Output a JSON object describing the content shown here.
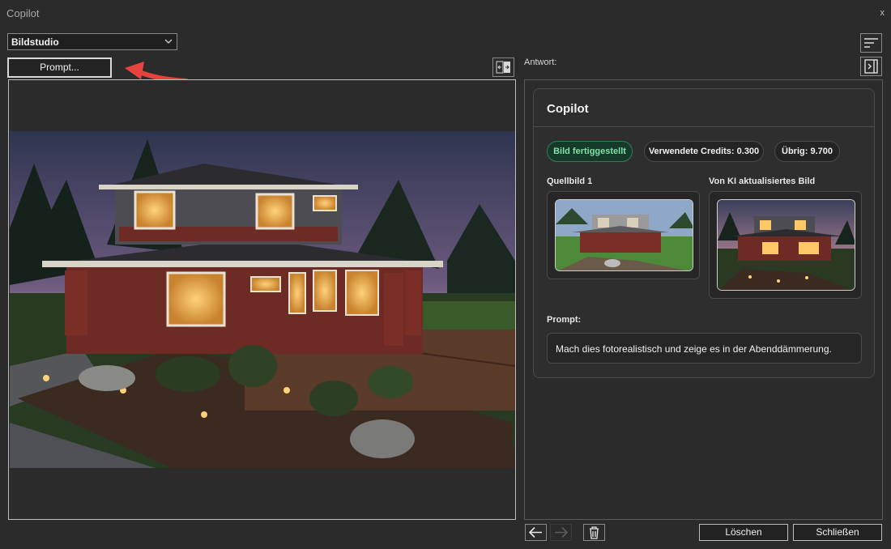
{
  "window": {
    "title": "Copilot",
    "close_label": "x"
  },
  "left": {
    "mode_select": {
      "value": "Bildstudio"
    },
    "prompt_button": "Prompt...",
    "main_image_icon": "house-photo"
  },
  "right": {
    "answer_label": "Antwort:",
    "card": {
      "title": "Copilot",
      "badges": {
        "status": "Bild fertiggestellt",
        "credits_used": "Verwendete Credits: 0.300",
        "remaining": "Übrig: 9.700"
      },
      "source_label": "Quellbild 1",
      "updated_label": "Von KI aktualisiertes Bild",
      "prompt_label": "Prompt:",
      "prompt_text": "Mach dies fotorealistisch und zeige es in der Abenddämmerung."
    }
  },
  "footer": {
    "delete_label": "Löschen",
    "close_label": "Schließen"
  },
  "colors": {
    "background": "#2b2b2b",
    "status_badge_bg": "#163a2a",
    "status_badge_text": "#7ee2a8",
    "annotation_arrow": "#e8423f"
  },
  "icons": {
    "dropdown": "chevron-down-icon",
    "swap": "swap-panels-icon",
    "menu": "sort-lines-icon",
    "collapse": "collapse-right-icon",
    "back": "arrow-left-icon",
    "forward": "arrow-right-icon",
    "trash": "trash-icon"
  }
}
